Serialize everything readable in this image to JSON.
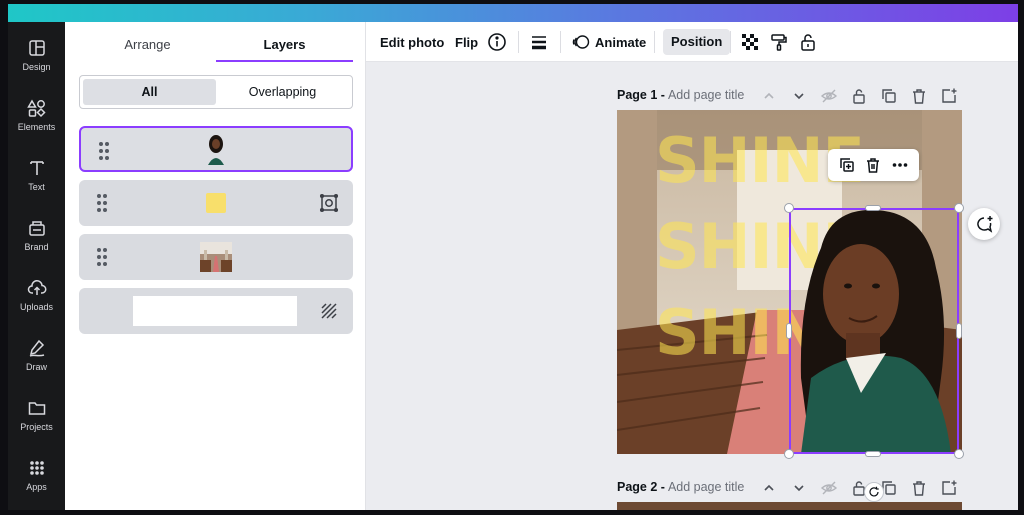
{
  "sidebar": {
    "items": [
      {
        "label": "Design",
        "icon": "layout-icon"
      },
      {
        "label": "Elements",
        "icon": "shapes-icon"
      },
      {
        "label": "Text",
        "icon": "text-icon"
      },
      {
        "label": "Brand",
        "icon": "brand-icon"
      },
      {
        "label": "Uploads",
        "icon": "cloud-upload-icon"
      },
      {
        "label": "Draw",
        "icon": "pen-icon"
      },
      {
        "label": "Projects",
        "icon": "folder-icon"
      },
      {
        "label": "Apps",
        "icon": "grid-icon"
      }
    ]
  },
  "panel": {
    "tabs": [
      {
        "label": "Arrange",
        "active": false
      },
      {
        "label": "Layers",
        "active": true
      }
    ],
    "filter": [
      {
        "label": "All",
        "active": true
      },
      {
        "label": "Overlapping",
        "active": false
      }
    ],
    "layers": [
      {
        "name": "woman-photo-layer",
        "selected": true
      },
      {
        "name": "yellow-shape-layer",
        "selected": false
      },
      {
        "name": "church-photo-layer",
        "selected": false
      },
      {
        "name": "background-layer",
        "selected": false
      }
    ]
  },
  "toolbar": {
    "edit_photo": "Edit photo",
    "flip": "Flip",
    "animate": "Animate",
    "position": "Position"
  },
  "pages": [
    {
      "label": "Page 1 -",
      "title_placeholder": "Add page title"
    },
    {
      "label": "Page 2 -",
      "title_placeholder": "Add page title"
    }
  ],
  "canvas": {
    "headline_lines": [
      "SHINE",
      "SHINE",
      "SHINE"
    ]
  },
  "colors": {
    "accent": "#8b3dff",
    "rail": "#18191b",
    "canvas_bg": "#ebecf0",
    "shine": "#ffe650"
  }
}
